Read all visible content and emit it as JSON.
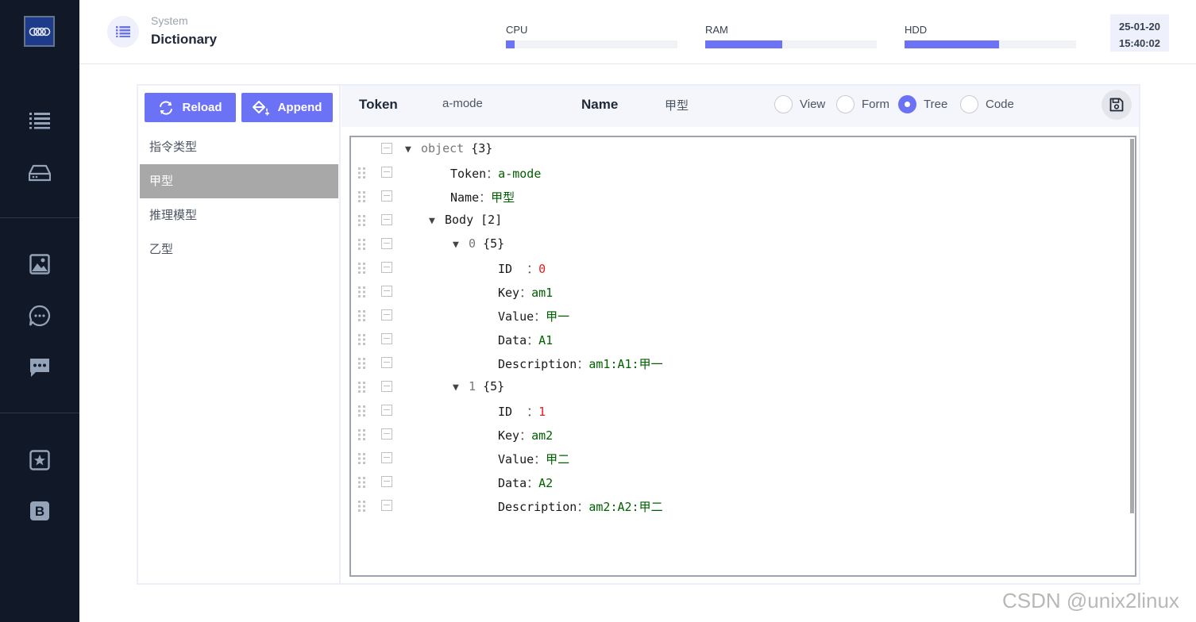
{
  "header": {
    "section": "System",
    "title": "Dictionary",
    "meters": [
      {
        "label": "CPU",
        "level": 0.05
      },
      {
        "label": "RAM",
        "level": 0.45
      },
      {
        "label": "HDD",
        "level": 0.55
      }
    ],
    "date": "25-01-20",
    "time": "15:40:02"
  },
  "sidebar": {
    "icons": [
      "list-icon",
      "drive-icon",
      "image-icon",
      "chat-icon",
      "message-icon",
      "star-icon",
      "bold-b-icon"
    ]
  },
  "left": {
    "reload_label": "Reload",
    "append_label": "Append",
    "items": [
      "指令类型",
      "甲型",
      "推理模型",
      "乙型"
    ],
    "selected_index": 1
  },
  "toolbar": {
    "token_label": "Token",
    "token_value": "a-mode",
    "name_label": "Name",
    "name_value": "甲型",
    "modes": [
      "View",
      "Form",
      "Tree",
      "Code"
    ],
    "selected_mode": "Tree"
  },
  "tree": {
    "root": {
      "key": "object",
      "count": "{3}"
    },
    "token": {
      "key": "Token",
      "sep": "：",
      "value": "a-mode"
    },
    "name": {
      "key": "Name",
      "sep": "：",
      "value": "甲型"
    },
    "body": {
      "key": "Body",
      "count": "[2]"
    },
    "items": [
      {
        "index": "0",
        "count": "{5}",
        "fields": [
          {
            "key": "ID  ",
            "sep": "：",
            "value": "0",
            "type": "num"
          },
          {
            "key": "Key",
            "sep": "：",
            "value": "am1",
            "type": "str"
          },
          {
            "key": "Value",
            "sep": "：",
            "value": "甲一",
            "type": "str"
          },
          {
            "key": "Data",
            "sep": "：",
            "value": "A1",
            "type": "str"
          },
          {
            "key": "Description",
            "sep": "：",
            "value": "am1:A1:甲一",
            "type": "str"
          }
        ]
      },
      {
        "index": "1",
        "count": "{5}",
        "fields": [
          {
            "key": "ID  ",
            "sep": "：",
            "value": "1",
            "type": "num"
          },
          {
            "key": "Key",
            "sep": "：",
            "value": "am2",
            "type": "str"
          },
          {
            "key": "Value",
            "sep": "：",
            "value": "甲二",
            "type": "str"
          },
          {
            "key": "Data",
            "sep": "：",
            "value": "A2",
            "type": "str"
          },
          {
            "key": "Description",
            "sep": "：",
            "value": "am2:A2:甲二",
            "type": "str"
          }
        ]
      }
    ]
  },
  "watermark": "CSDN @unix2linux",
  "colors": {
    "accent": "#6c72f5",
    "sidebar": "#111827",
    "selected_item": "#a8a8a8"
  }
}
